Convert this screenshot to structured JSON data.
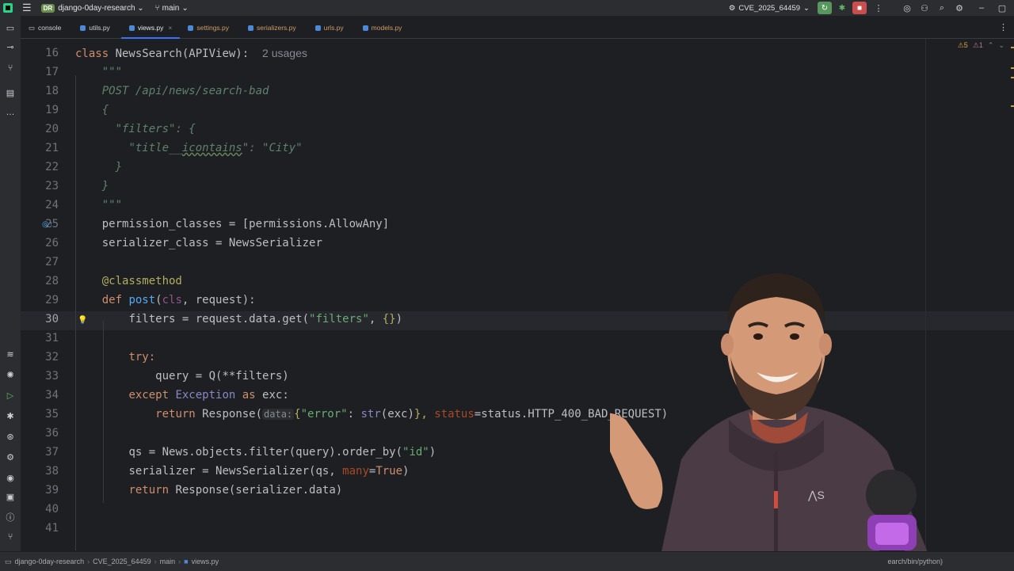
{
  "titlebar": {
    "project_badge": "DR",
    "project_name": "django-0day-research",
    "branch": "main",
    "run_config": "CVE_2025_64459"
  },
  "tabs": [
    {
      "label": "console",
      "active": false
    },
    {
      "label": "utils.py",
      "active": false
    },
    {
      "label": "views.py",
      "active": true
    },
    {
      "label": "settings.py",
      "active": false
    },
    {
      "label": "serializers.py",
      "active": false
    },
    {
      "label": "urls.py",
      "active": false
    },
    {
      "label": "models.py",
      "active": false
    }
  ],
  "editor": {
    "warnings_count": "5",
    "weak_warnings_count": "1",
    "current_line": "30",
    "usages": "2 usages",
    "hint_data": "data:",
    "line_numbers": [
      "16",
      "17",
      "18",
      "19",
      "20",
      "21",
      "22",
      "23",
      "24",
      "25",
      "26",
      "27",
      "28",
      "29",
      "30",
      "31",
      "32",
      "33",
      "34",
      "35",
      "36",
      "37",
      "38",
      "39",
      "40",
      "41"
    ],
    "code": {
      "l16_a": "class ",
      "l16_b": "NewsSearch",
      "l16_c": "(APIView):",
      "l17": "\"\"\"",
      "l18": "POST /api/news/search-bad",
      "l19": "{",
      "l20": "\"filters\": {",
      "l21_a": "\"title__",
      "l21_b": "icontains",
      "l21_c": "\": \"City\"",
      "l22": "}",
      "l23": "}",
      "l24": "\"\"\"",
      "l25": "permission_classes = [permissions.AllowAny]",
      "l26": "serializer_class = NewsSerializer",
      "l28": "@classmethod",
      "l29_a": "def ",
      "l29_b": "post",
      "l29_c": "(",
      "l29_d": "cls",
      "l29_e": ", request):",
      "l30_a": "filters = request.data.get(",
      "l30_b": "\"filters\"",
      "l30_c": ", ",
      "l30_d": "{}",
      "l30_e": ")",
      "l32": "try:",
      "l33": "query = Q(**filters)",
      "l34_a": "except ",
      "l34_b": "Exception",
      "l34_c": " as ",
      "l34_d": "exc:",
      "l35_a": "return ",
      "l35_b": "Response(",
      "l35_c": "{",
      "l35_d": "\"error\"",
      "l35_e": ": ",
      "l35_f": "str",
      "l35_g": "(exc)",
      "l35_h": "}, ",
      "l35_i": "status",
      "l35_j": "=status.HTTP_400_BAD_REQUEST)",
      "l37_a": "qs = News.objects.filter(query).order_by(",
      "l37_b": "\"id\"",
      "l37_c": ")",
      "l38_a": "serializer = NewsSerializer(qs, ",
      "l38_b": "many",
      "l38_c": "=",
      "l38_d": "True",
      "l38_e": ")",
      "l39_a": "return ",
      "l39_b": "Response(serializer.data)"
    }
  },
  "statusbar": {
    "crumbs": [
      "django-0day-research",
      "CVE_2025_64459",
      "main",
      "views.py"
    ],
    "interpreter": "earch/bin/python)"
  },
  "colors": {
    "background": "#1e1f22",
    "keyword": "#cf8e6d",
    "function": "#56a8f5",
    "string": "#6aab73",
    "docstring": "#5f826b",
    "decorator": "#b3ae60",
    "accent": "#3574f0"
  }
}
